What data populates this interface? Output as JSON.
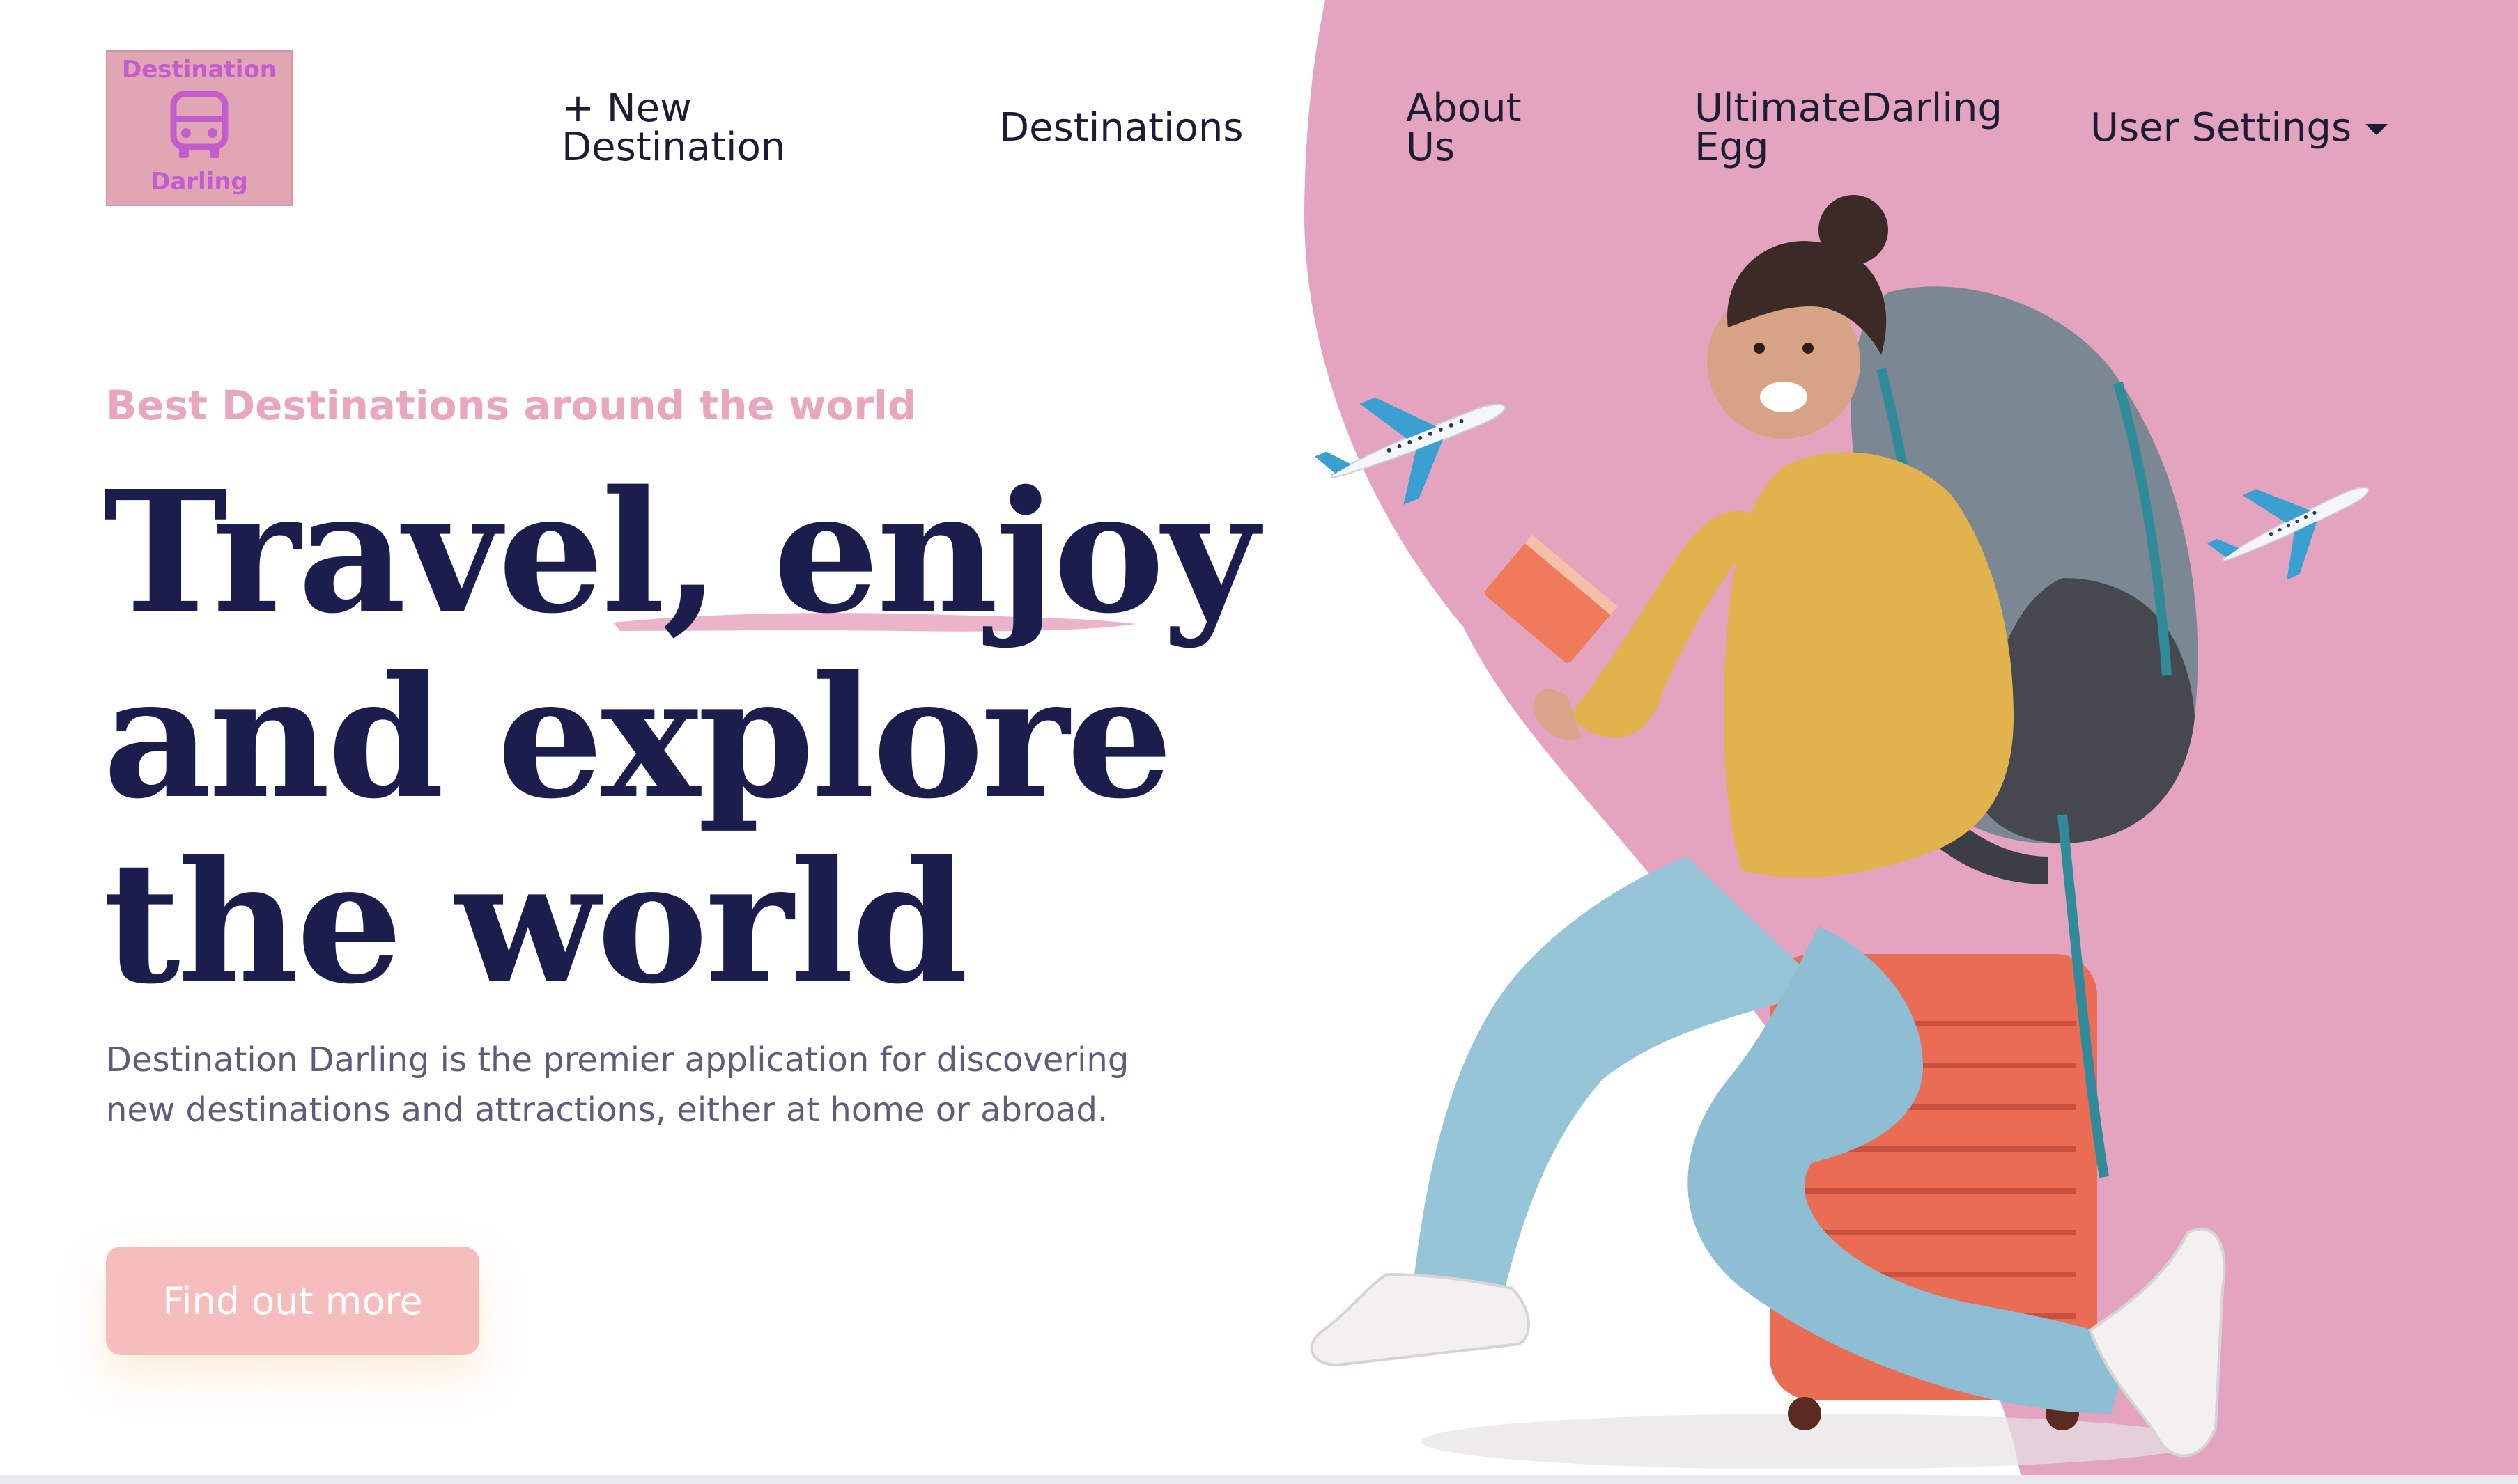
{
  "colors": {
    "accent_pink": "#e4a4c0",
    "logo_bg": "#e0a6b4",
    "logo_text": "#c35ccf",
    "headline": "#1b1e4d",
    "eyebrow": "#e8a6bf",
    "body_text": "#5c5d78",
    "cta_bg": "#f5bdbe",
    "cta_text": "#ffffff"
  },
  "logo": {
    "top_text": "Destination",
    "bottom_text": "Darling",
    "icon": "bus-icon"
  },
  "nav": {
    "new_destination": "+ New Destination",
    "destinations": "Destinations",
    "about": "About Us",
    "account": "UltimateDarling Egg",
    "settings": "User Settings"
  },
  "hero": {
    "eyebrow": "Best Destinations around the world",
    "headline_lines": [
      "Travel, enjoy",
      "and explore",
      "the world"
    ],
    "description": "Destination Darling is the premier application for discovering new destinations and attractions, either at home or abroad.",
    "cta": "Find out more"
  },
  "illustration": {
    "subject": "traveler-illustration",
    "decorations": [
      "airplane-icon",
      "airplane-icon"
    ]
  }
}
